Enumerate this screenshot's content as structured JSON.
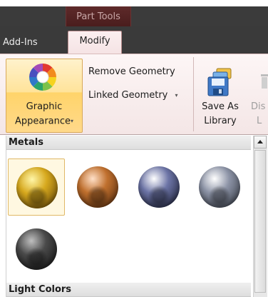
{
  "contextual_tab": {
    "label": "Part Tools"
  },
  "tabs": [
    {
      "label": "Add-Ins",
      "active": false
    },
    {
      "label": "Modify",
      "active": true
    }
  ],
  "ribbon": {
    "graphic_appearance": {
      "line1": "Graphic",
      "line2": "Appearance",
      "dropdown": "▾"
    },
    "remove_geometry": {
      "label": "Remove Geometry"
    },
    "linked_geometry": {
      "label": "Linked Geometry",
      "dropdown": "▾"
    },
    "save_as_library": {
      "line1": "Save As",
      "line2": "Library"
    },
    "cut_off": {
      "line1": "Dis",
      "line2": "L"
    }
  },
  "gallery": {
    "sections": [
      {
        "title": "Metals",
        "items": [
          {
            "name": "gold",
            "selected": true,
            "colors": [
              "#fff6a8",
              "#d7a91e",
              "#5a3d05"
            ]
          },
          {
            "name": "copper",
            "selected": false,
            "colors": [
              "#ffe0c8",
              "#c0702e",
              "#4b240a"
            ]
          },
          {
            "name": "steel-blue",
            "selected": false,
            "colors": [
              "#ffffff",
              "#6c74a6",
              "#121526"
            ]
          },
          {
            "name": "silver",
            "selected": false,
            "colors": [
              "#ffffff",
              "#8c93a6",
              "#2b2f38"
            ]
          },
          {
            "name": "black-chrome",
            "selected": false,
            "colors": [
              "#bfbfbf",
              "#4a4a4a",
              "#0c0c0c"
            ]
          }
        ]
      },
      {
        "title": "Light Colors",
        "items": []
      }
    ]
  }
}
